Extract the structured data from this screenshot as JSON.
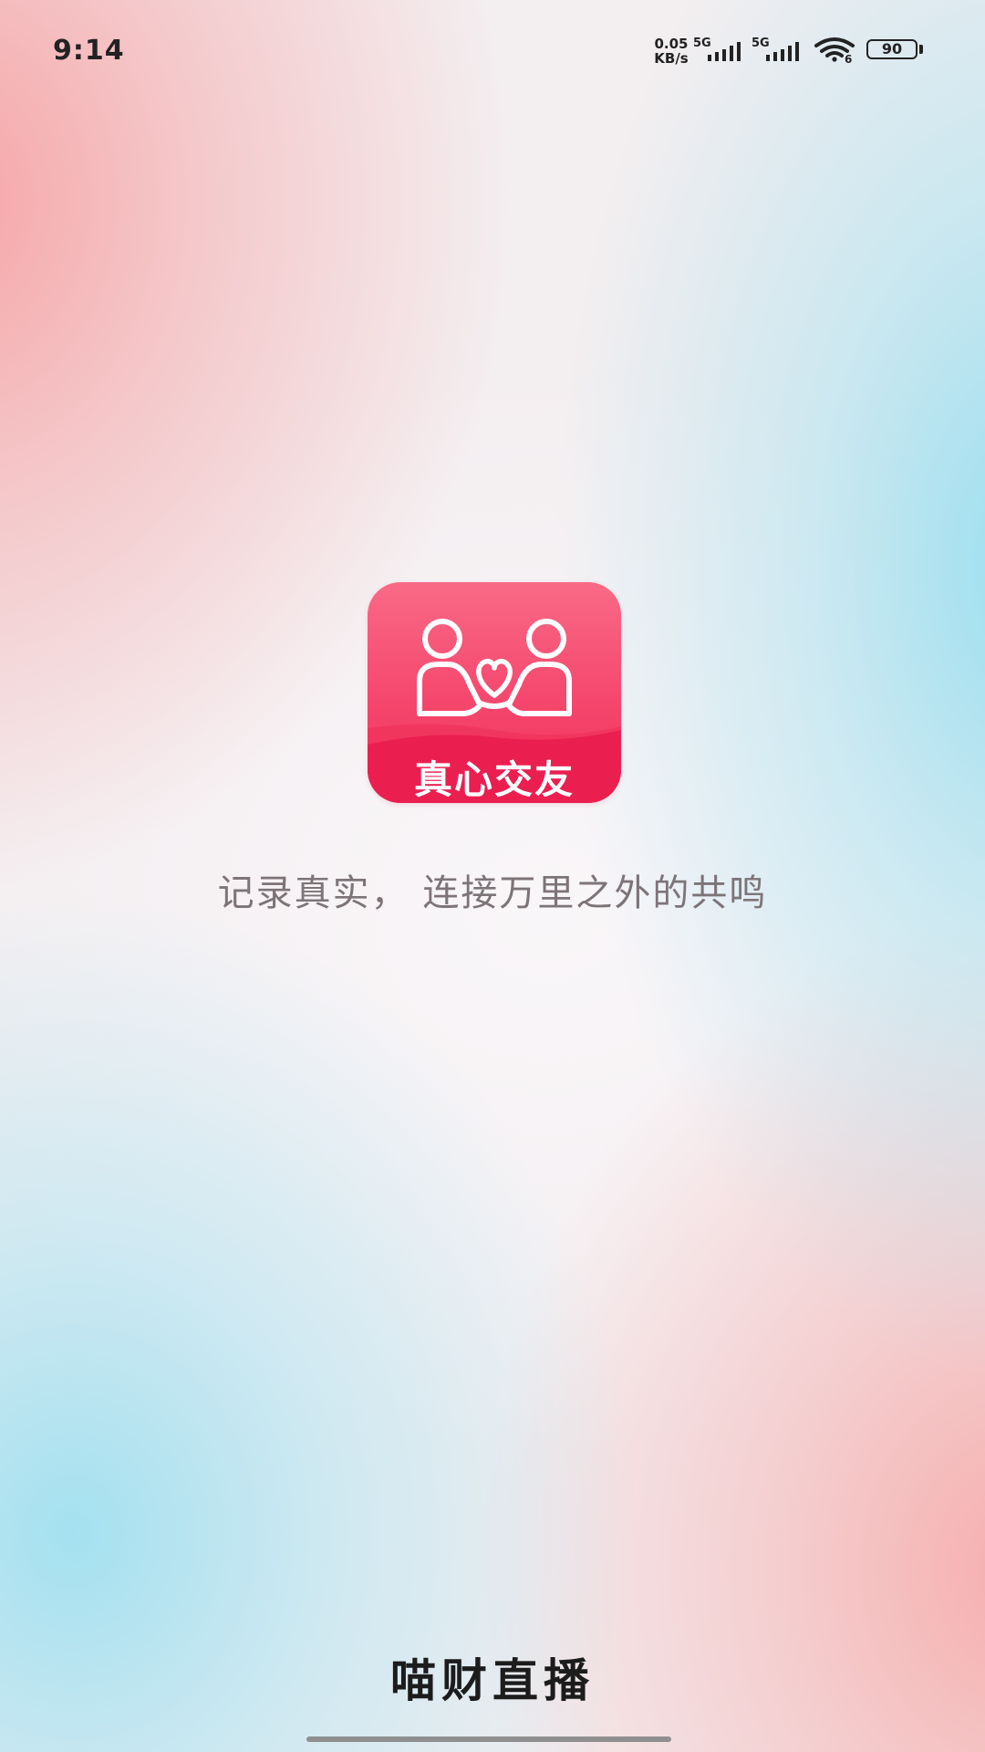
{
  "status_bar": {
    "time": "9:14",
    "net_speed_value": "0.05",
    "net_speed_unit": "KB/s",
    "sim1_network": "5G",
    "sim2_network": "5G",
    "wifi_label": "6",
    "battery_level": "90",
    "icons": [
      "signal-icon",
      "signal-icon",
      "wifi-icon",
      "battery-icon"
    ]
  },
  "splash": {
    "logo_text": "真心交友",
    "logo_icon": "couple-heart-icon",
    "tagline": "记录真实， 连接万里之外的共鸣",
    "brand_name": "喵财直播"
  },
  "colors": {
    "logo_top": "#f96a86",
    "logo_bottom": "#f0325a",
    "tagline": "#7d7478",
    "brand": "#1c1c1c"
  }
}
